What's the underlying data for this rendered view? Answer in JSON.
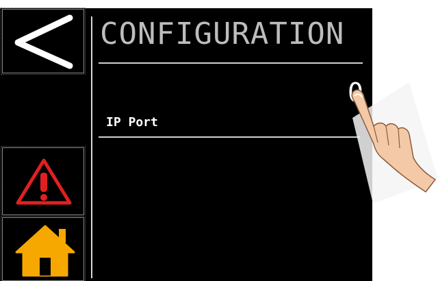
{
  "header": {
    "title": "CONFIGURATION"
  },
  "settings": {
    "rows": [
      {
        "label": "IP Port",
        "value": "0"
      }
    ]
  },
  "sidebar": {
    "buttons": [
      {
        "icon": "back-arrow-icon",
        "color": "#ffffff"
      },
      {
        "icon": "warning-icon",
        "color": "#e02020"
      },
      {
        "icon": "home-icon",
        "color": "#f7a800"
      }
    ]
  },
  "colors": {
    "background": "#000000",
    "title_text": "#bdbdbd",
    "row_text": "#ffffff",
    "divider": "#d0d0d0",
    "warning": "#e02020",
    "home": "#f7a800"
  }
}
